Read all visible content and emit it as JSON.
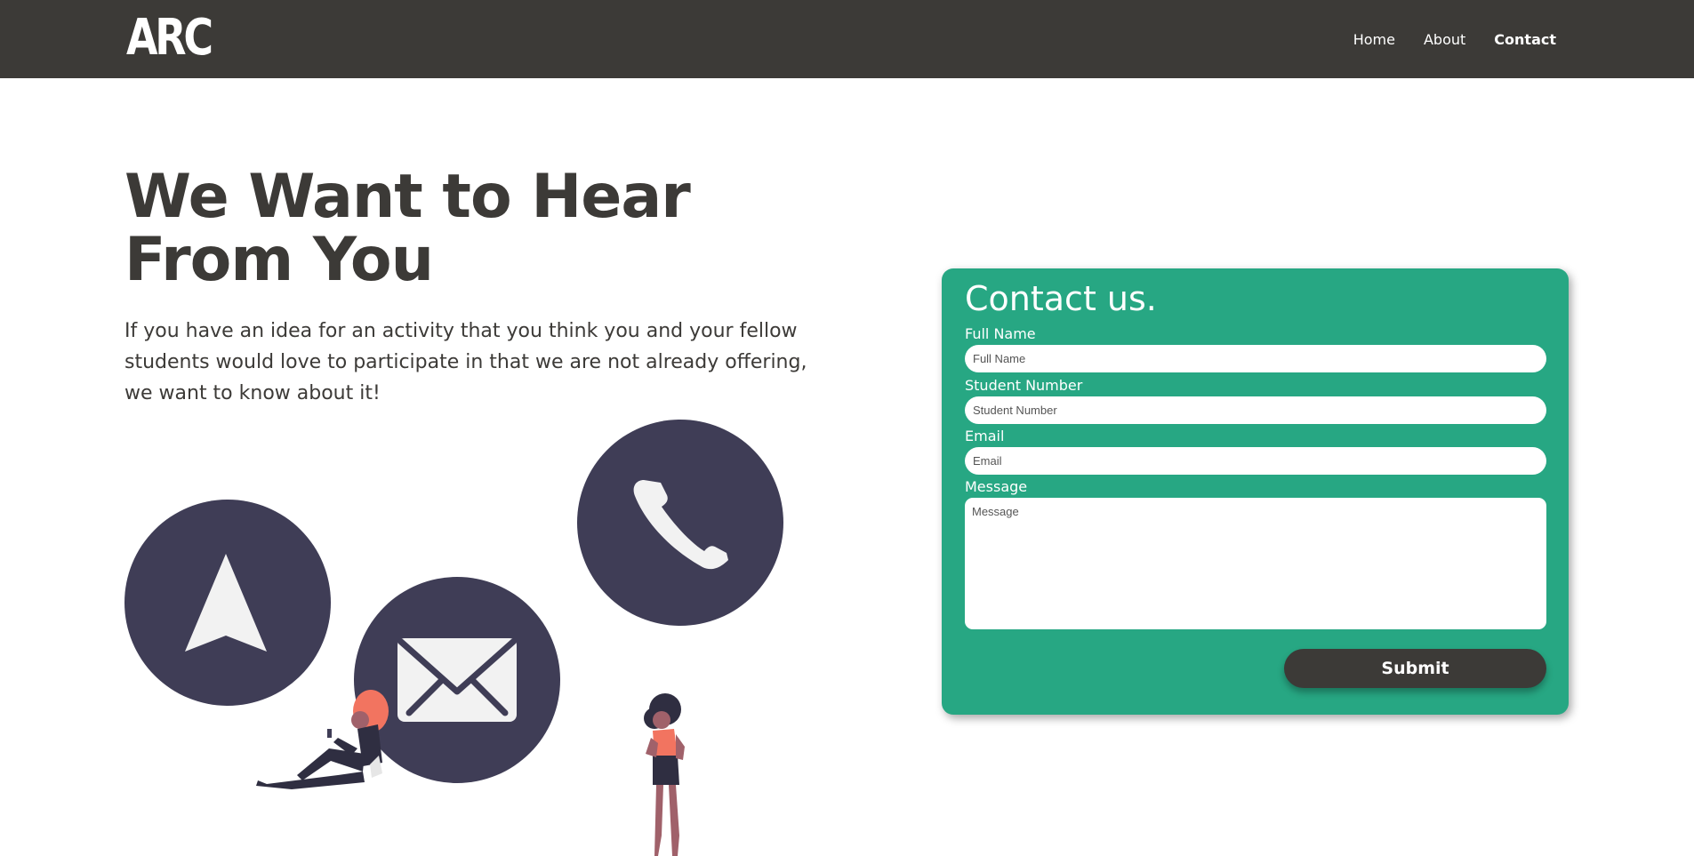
{
  "header": {
    "logo_text": "ARC",
    "nav": [
      {
        "label": "Home",
        "active": false
      },
      {
        "label": "About",
        "active": false
      },
      {
        "label": "Contact",
        "active": true
      }
    ]
  },
  "hero": {
    "title": "We Want to Hear From You",
    "text": "If you have an idea for an activity that you think you and your fellow students would love to participate in that we are not already offering, we want to know about it!"
  },
  "illustration": {
    "icons": [
      "navigation-arrow-icon",
      "envelope-icon",
      "phone-icon"
    ]
  },
  "contact_form": {
    "title": "Contact us.",
    "full_name": {
      "label": "Full Name",
      "placeholder": "Full Name",
      "value": ""
    },
    "student_number": {
      "label": "Student Number",
      "placeholder": "Student Number",
      "value": ""
    },
    "email": {
      "label": "Email",
      "placeholder": "Email",
      "value": ""
    },
    "message": {
      "label": "Message",
      "placeholder": "Message",
      "value": ""
    },
    "submit_label": "Submit"
  },
  "colors": {
    "nav_background": "#3c3a37",
    "text_dark": "#3c3a37",
    "card_green": "#27a783",
    "icon_circle": "#3f3d56",
    "accent_coral": "#f27460"
  }
}
